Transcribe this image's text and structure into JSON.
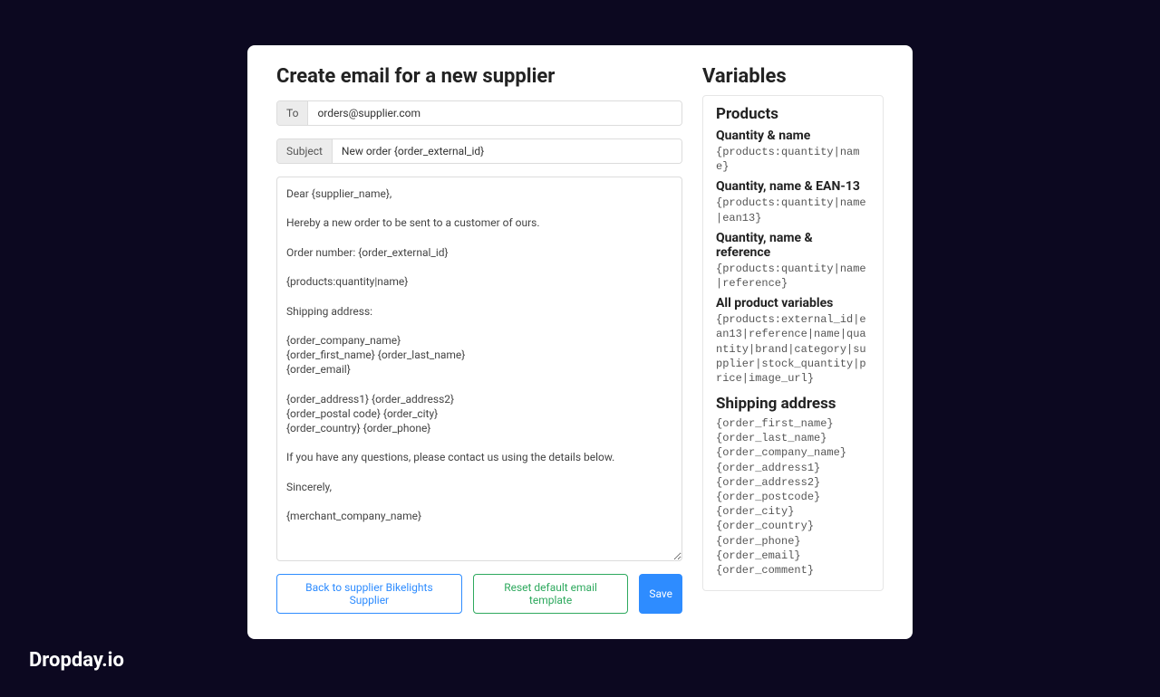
{
  "pageTitle": "Create email for a new supplier",
  "to": {
    "label": "To",
    "value": "orders@supplier.com"
  },
  "subject": {
    "label": "Subject",
    "value": "New order {order_external_id}"
  },
  "body": "Dear {supplier_name},\n\nHereby a new order to be sent to a customer of ours.\n\nOrder number: {order_external_id}\n\n{products:quantity|name}\n\nShipping address:\n\n{order_company_name}\n{order_first_name} {order_last_name}\n{order_email}\n\n{order_address1} {order_address2}\n{order_postal code} {order_city}\n{order_country} {order_phone}\n\nIf you have any questions, please contact us using the details below.\n\nSincerely,\n\n{merchant_company_name}",
  "buttons": {
    "back": "Back to supplier Bikelights Supplier",
    "reset": "Reset default email template",
    "save": "Save"
  },
  "variables": {
    "title": "Variables",
    "products": {
      "heading": "Products",
      "qn": {
        "label": "Quantity & name",
        "code": "{products:quantity|name}"
      },
      "qne": {
        "label": "Quantity, name & EAN-13",
        "code": "{products:quantity|name|ean13}"
      },
      "qnr": {
        "label": "Quantity, name & reference",
        "code": "{products:quantity|name|reference}"
      },
      "all": {
        "label": "All product variables",
        "code": "{products:external_id|ean13|reference|name|quantity|brand|category|supplier|stock_quantity|price|image_url}"
      }
    },
    "shipping": {
      "heading": "Shipping address",
      "code": "{order_first_name}\n{order_last_name}\n{order_company_name}\n{order_address1}\n{order_address2}\n{order_postcode}\n{order_city}\n{order_country}\n{order_phone}\n{order_email}\n{order_comment}"
    }
  },
  "brand": "Dropday.io"
}
